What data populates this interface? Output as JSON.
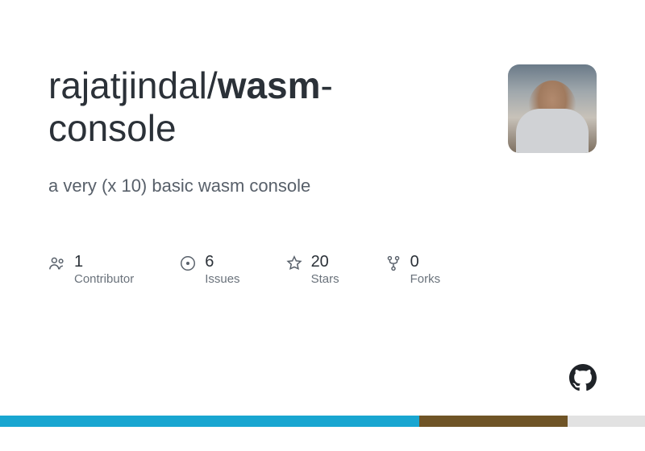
{
  "repo": {
    "owner": "rajatjindal",
    "slash": "/",
    "name_bold": "wasm",
    "name_hyphen": "-",
    "name_rest": "console"
  },
  "description": "a very (x 10) basic wasm console",
  "stats": {
    "contributors": {
      "count": "1",
      "label": "Contributor"
    },
    "issues": {
      "count": "6",
      "label": "Issues"
    },
    "stars": {
      "count": "20",
      "label": "Stars"
    },
    "forks": {
      "count": "0",
      "label": "Forks"
    }
  },
  "language_bar": [
    {
      "width": "65%",
      "color": "#19a6d1"
    },
    {
      "width": "23%",
      "color": "#6f5426"
    },
    {
      "width": "12%",
      "color": "#e2e2e2"
    }
  ]
}
